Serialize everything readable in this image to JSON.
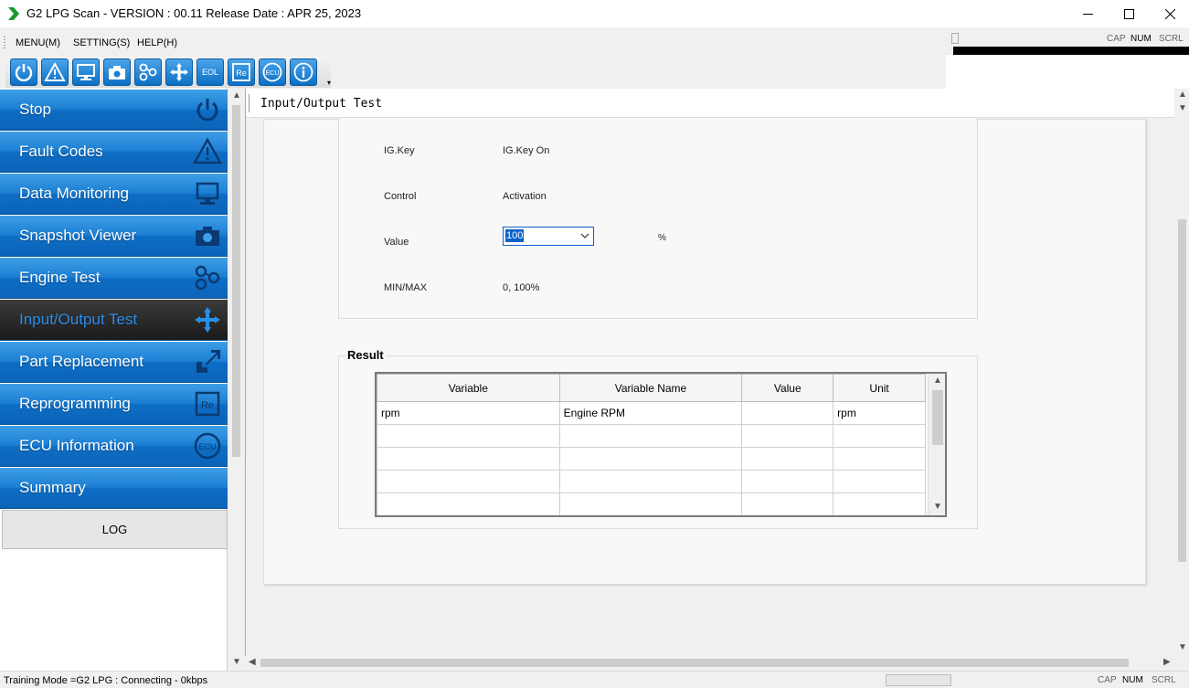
{
  "window": {
    "title": "G2 LPG Scan - VERSION : 00.11 Release Date : APR 25, 2023",
    "controls": [
      "minimize",
      "maximize",
      "close"
    ]
  },
  "menu": {
    "items": [
      {
        "label": "MENU(M)"
      },
      {
        "label": "SETTING(S)"
      },
      {
        "label": "HELP(H)"
      }
    ]
  },
  "key_indicators": {
    "cap": "CAP",
    "num": "NUM",
    "scrl": "SCRL"
  },
  "toolbar": {
    "buttons": [
      {
        "icon": "power-icon"
      },
      {
        "icon": "warning-icon"
      },
      {
        "icon": "monitor-icon"
      },
      {
        "icon": "camera-icon"
      },
      {
        "icon": "engine-test-icon"
      },
      {
        "icon": "io-arrows-icon"
      },
      {
        "icon": "eol-icon",
        "text": "EOL"
      },
      {
        "icon": "reprogram-icon",
        "text": "Re"
      },
      {
        "icon": "ecu-icon",
        "text": "ECU"
      },
      {
        "icon": "info-icon"
      }
    ]
  },
  "sidebar": {
    "items": [
      {
        "label": "Stop",
        "icon": "power-icon"
      },
      {
        "label": "Fault Codes",
        "icon": "warning-icon"
      },
      {
        "label": "Data Monitoring",
        "icon": "monitor-icon"
      },
      {
        "label": "Snapshot Viewer",
        "icon": "camera-icon"
      },
      {
        "label": "Engine Test",
        "icon": "engine-test-icon"
      },
      {
        "label": "Input/Output Test",
        "icon": "io-arrows-icon",
        "active": true
      },
      {
        "label": "Part Replacement",
        "icon": "part-replace-icon"
      },
      {
        "label": "Reprogramming",
        "icon": "reprogram-icon"
      },
      {
        "label": "ECU Information",
        "icon": "ecu-icon"
      },
      {
        "label": "Summary",
        "icon": ""
      }
    ],
    "log_label": "LOG"
  },
  "main": {
    "title": "Input/Output Test",
    "fields": [
      {
        "label": "IG.Key",
        "value": "IG.Key On"
      },
      {
        "label": "Control",
        "value": "Activation"
      },
      {
        "label": "Value",
        "value": "100",
        "unit": "%"
      },
      {
        "label": "MIN/MAX",
        "value": "0,  100%"
      }
    ],
    "result": {
      "title": "Result",
      "columns": [
        "Variable",
        "Variable Name",
        "Value",
        "Unit"
      ],
      "rows": [
        [
          "rpm",
          "Engine RPM",
          "",
          "rpm"
        ],
        [
          "",
          "",
          "",
          ""
        ],
        [
          "",
          "",
          "",
          ""
        ],
        [
          "",
          "",
          "",
          ""
        ],
        [
          "",
          "",
          "",
          ""
        ]
      ]
    }
  },
  "status": {
    "text": "Training Mode =G2 LPG : Connecting - 0kbps"
  },
  "colors": {
    "nav_blue": "#1c7fd3",
    "nav_active": "#1b1b1b",
    "active_text": "#2a8ee8",
    "selection": "#0c63c8"
  }
}
